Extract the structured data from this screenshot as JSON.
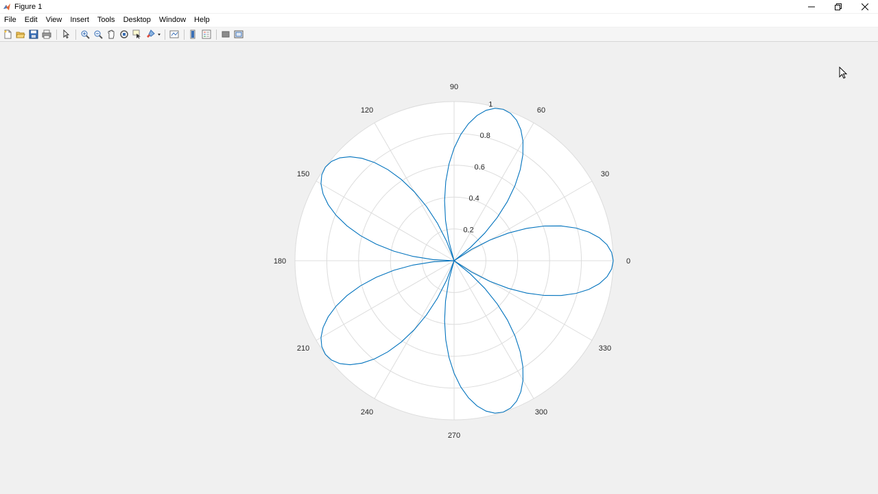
{
  "window": {
    "title": "Figure 1"
  },
  "menu": {
    "items": [
      "File",
      "Edit",
      "View",
      "Insert",
      "Tools",
      "Desktop",
      "Window",
      "Help"
    ]
  },
  "toolbar": {
    "icons": [
      "new-figure-icon",
      "open-file-icon",
      "save-icon",
      "print-icon",
      "edit-plot-icon",
      "zoom-in-icon",
      "zoom-out-icon",
      "pan-icon",
      "rotate-3d-icon",
      "data-cursor-icon",
      "brush-icon",
      "link-plot-icon",
      "insert-colorbar-icon",
      "insert-legend-icon",
      "hide-plot-tools-icon",
      "show-plot-tools-icon"
    ]
  },
  "chart_data": {
    "type": "line",
    "subtype": "polar",
    "equation_shape": "rose r = |cos(2.5 θ)|, 5 petals",
    "theta_ticks": [
      0,
      30,
      60,
      90,
      120,
      150,
      180,
      210,
      240,
      270,
      300,
      330
    ],
    "theta_tick_labels": [
      "0",
      "30",
      "60",
      "90",
      "120",
      "150",
      "180",
      "210",
      "240",
      "270",
      "300",
      "330"
    ],
    "r_ticks": [
      0.2,
      0.4,
      0.6,
      0.8,
      1
    ],
    "r_tick_labels": [
      "0.2",
      "0.4",
      "0.6",
      "0.8",
      "1"
    ],
    "rlim": [
      0,
      1
    ],
    "petal_centers_deg": [
      0,
      72,
      144,
      216,
      288
    ],
    "series": [
      {
        "color": "#0072bd",
        "points_per_petal_step_deg": 6
      }
    ],
    "grid": true,
    "colors": {
      "grid": "#dcdcdc",
      "axes_bg": "#ffffff",
      "line": "#0072bd"
    }
  }
}
